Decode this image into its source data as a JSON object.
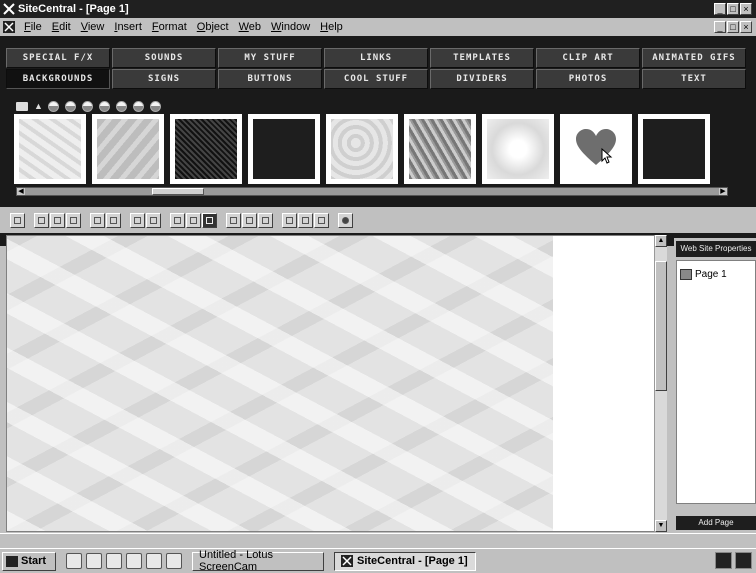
{
  "window": {
    "title": "SiteCentral - [Page 1]",
    "controls": [
      "_",
      "□",
      "×"
    ]
  },
  "menu": {
    "items": [
      "File",
      "Edit",
      "View",
      "Insert",
      "Format",
      "Object",
      "Web",
      "Window",
      "Help"
    ]
  },
  "categories": {
    "row1": [
      "SPECIAL F/X",
      "SOUNDS",
      "MY STUFF",
      "LINKS",
      "TEMPLATES",
      "CLIP ART",
      "ANIMATED GIFS"
    ],
    "row2": [
      "BACKGROUNDS",
      "SIGNS",
      "BUTTONS",
      "COOL STUFF",
      "DIVIDERS",
      "PHOTOS",
      "TEXT"
    ],
    "active": "BACKGROUNDS"
  },
  "gallery": {
    "thumbnails": [
      "light-marble",
      "gray-clouds",
      "dark-texture",
      "black",
      "light-gray",
      "gray-stone",
      "starburst",
      "heart",
      "black"
    ],
    "accent_heart": "#6e6e6e"
  },
  "right_panel": {
    "header": "Web Site Properties",
    "pages": [
      "Page 1"
    ],
    "add_button": "Add Page"
  },
  "taskbar": {
    "start": "Start",
    "tasks": [
      {
        "label": "Untitled - Lotus ScreenCam",
        "active": false
      },
      {
        "label": "SiteCentral - [Page 1]",
        "active": true
      }
    ]
  }
}
